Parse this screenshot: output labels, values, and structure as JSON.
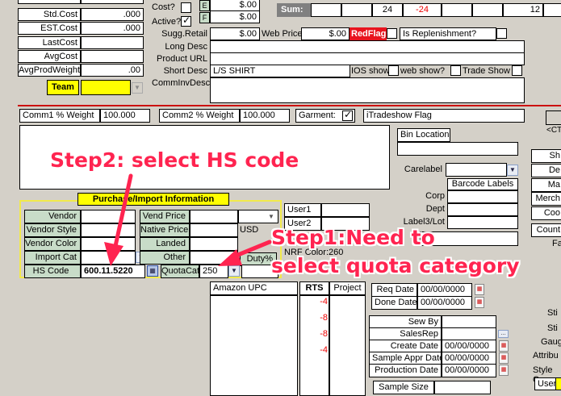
{
  "top_left": {
    "labels": [
      "Std.Cost",
      "EST.Cost",
      "LastCost",
      "AvgCost",
      "AvgProdWeight"
    ],
    "values": [
      ".000",
      ".000",
      "",
      "",
      ".00"
    ],
    "team_label": "Team"
  },
  "cost_flags": {
    "cost_label": "Cost?",
    "active_label": "Active?",
    "e_label": "E",
    "f_label": "F",
    "dollar_a": "$.00",
    "dollar_b": "$.00"
  },
  "sum_bar": {
    "label": "Sum:",
    "v1": "24",
    "v2": "-24",
    "v3": "12"
  },
  "retail": {
    "sugg_label": "Sugg.Retail",
    "sugg_value": "$.00",
    "web_label": "Web Price",
    "web_value": "$.00",
    "redflag_label": "RedFlag",
    "replenish_label": "Is Replenishment?"
  },
  "descs": {
    "long_label": "Long Desc",
    "product_url_label": "Product URL",
    "short_label": "Short Desc",
    "short_value": "L/S SHIRT",
    "comminv_label": "CommInvDesc",
    "ios_label": "IOS show",
    "web_show_label": "web show?",
    "trade_show_label": "Trade Show"
  },
  "weights": {
    "comm1_label": "Comm1 % Weight",
    "comm1_value": "100.000",
    "comm2_label": "Comm2 % Weight",
    "comm2_value": "100.000",
    "garment_label": "Garment:",
    "itradeshow_label": "iTradeshow Flag"
  },
  "bin": {
    "bin_label": "Bin Location",
    "carelabel_label": "Carelabel",
    "barcode_header": "Barcode Labels",
    "corp": "Corp",
    "dept": "Dept",
    "label3": "Label3/Lot"
  },
  "purchase": {
    "title": "Purchase/Import Information",
    "vendor": "Vendor",
    "vendor_style": "Vendor Style",
    "vendor_color": "Vendor Color",
    "import_cat": "Import Cat",
    "hs_code_label": "HS Code",
    "hs_code_value": "600.11.5220",
    "vend_price": "Vend Price",
    "native_price": "Native Price",
    "native_currency": "USD",
    "landed": "Landed",
    "other": "Other",
    "duty": "Duty%",
    "quotacat_label": "QuotaCat",
    "quotacat_value": "250"
  },
  "users": {
    "user1": "User1",
    "user2": "User2",
    "nrf": "NRF Color:260"
  },
  "lower": {
    "amazon_upc": "Amazon UPC",
    "rts": "RTS",
    "project": "Project",
    "rts_values": [
      "-4",
      "-8",
      "-8",
      "-4"
    ],
    "req_date": "Req Date",
    "req_value": "00/00/0000",
    "done_date": "Done Date",
    "done_value": "00/00/0000",
    "sew_by": "Sew By",
    "salesrep": "SalesRep",
    "create_date": "Create Date",
    "create_value": "00/00/0000",
    "sample_appr": "Sample Appr Date",
    "sample_value": "00/00/0000",
    "production": "Production Date",
    "production_value": "00/00/0000",
    "sample_size": "Sample Size"
  },
  "right_edge": {
    "ct": "<CT",
    "items": [
      "Sh",
      "De",
      "Ma",
      "Merch",
      "Coo",
      "Count",
      "Fa",
      "Sti",
      "Sti",
      "Gaug",
      "Attribu",
      "Style C",
      "User"
    ]
  },
  "annotations": {
    "step2": "Step2: select HS code",
    "step1_line1": "Step1:Need to",
    "step1_line2": "select quota category"
  }
}
